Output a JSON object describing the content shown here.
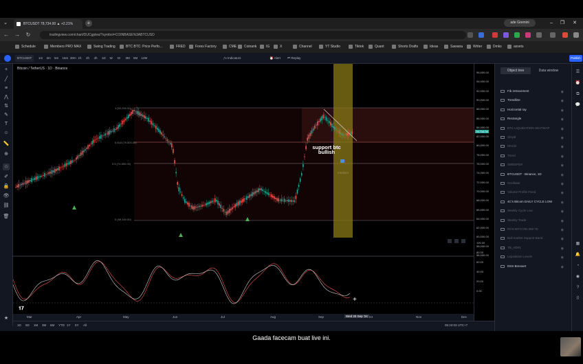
{
  "browser": {
    "tab_title": "BTCUSDT 78,734.00 ▲ +2.21%",
    "new_tab": "+",
    "profile_label": "ade Gremini",
    "url": "tradingview.com/chart/DUCgplea/?symbol=COINBASE%3ABTCUSD",
    "bookmarks": [
      "Schedule",
      "Members PRO MAX",
      "Swing Trading",
      "BTC BTC: Price Perfo...",
      "FRED",
      "Forex Factory",
      "CME",
      "Coinank",
      "IG",
      "X",
      "Channel",
      "YT Studio",
      "Tiktok",
      "Quant",
      "Shorts Drafts",
      "Ideas",
      "Sawana",
      "Writer",
      "Dmks",
      "assets"
    ]
  },
  "toolbar": {
    "symbol": "BTCUSDT",
    "timeframes": [
      "1m",
      "3m",
      "5m",
      "15m",
      "30m",
      "1h",
      "2h",
      "4h",
      "1D",
      "W",
      "M",
      "3M",
      "6M",
      "12M"
    ],
    "indicators_label": "Indicators",
    "alert_label": "Alert",
    "replay_label": "Replay",
    "publish_label": "Publish"
  },
  "chart": {
    "legend": "Bitcoin / TetherUS · 1D · Binance",
    "fib_levels": [
      "1 (92,200.00)",
      "0.618 (79,500.00)",
      "0.5 (74,500.00)",
      "0 (59,100.00)"
    ],
    "annotation_line1": "support btc",
    "annotation_line2": "bullish",
    "annotation_sub": "medium",
    "price_labels": [
      "96,000.00",
      "94,000.00",
      "92,000.00",
      "90,000.00",
      "88,000.00",
      "86,000.00",
      "84,000.00",
      "82,000.00",
      "80,000.00",
      "78,000.00",
      "76,000.00",
      "74,000.00",
      "72,000.00",
      "70,000.00",
      "68,000.00",
      "66,000.00",
      "64,000.00",
      "62,000.00",
      "60,000.00",
      "58,000.00",
      "56,000.00"
    ],
    "current_price": "78,734.00",
    "osc_labels": [
      "100.00",
      "80.00",
      "60.00",
      "40.00",
      "20.00",
      "0.00"
    ],
    "time_labels": [
      "Mar",
      "Apr",
      "May",
      "Jun",
      "Jul",
      "Aug",
      "Sep",
      "Oct",
      "Nov",
      "Dec"
    ],
    "cursor_date": "Wed 25 Sep '24",
    "clock": "05:22:03 UTC+7"
  },
  "bottom": {
    "ranges": [
      "1D",
      "5D",
      "1M",
      "3M",
      "6M",
      "YTD",
      "1Y",
      "5Y",
      "All"
    ]
  },
  "panel": {
    "tabs": [
      "Object tree",
      "Data window"
    ],
    "objects": [
      {
        "label": "Fib retracement",
        "dim": false
      },
      {
        "label": "Trendline",
        "dim": false
      },
      {
        "label": "Horizontal ray",
        "dim": false
      },
      {
        "label": "Rectangle",
        "dim": false
      },
      {
        "label": "BTC LIQUIDATION HEATMAP",
        "dim": true
      },
      {
        "label": "Sinyal",
        "dim": true
      },
      {
        "label": "MACD",
        "dim": true
      },
      {
        "label": "Trend",
        "dim": true
      },
      {
        "label": "SWEEPER",
        "dim": true
      },
      {
        "label": "BTCUSDT · Binance, 1D",
        "dim": false
      },
      {
        "label": "Oscillator",
        "dim": true
      },
      {
        "label": "Volume Profile Fixed",
        "dim": true
      },
      {
        "label": "4C's Bitcoin DAILY CYCLE LOW",
        "dim": false
      },
      {
        "label": "Weekly Cycle Low",
        "dim": true
      },
      {
        "label": "Weekly Trade",
        "dim": true
      },
      {
        "label": "RCN BITCOIN 365 TE",
        "dim": true
      },
      {
        "label": "Bull market Support Band",
        "dim": true
      },
      {
        "label": "TB_ADRL",
        "dim": true
      },
      {
        "label": "Liquidation Levels",
        "dim": true
      },
      {
        "label": "DSS Bressert",
        "dim": false
      }
    ]
  },
  "caption": "Gaada facecam buat live ini.",
  "colors": {
    "bull": "#26a69a",
    "bear": "#ef5350",
    "highlight": "#d4c030",
    "fib_zone": "#2a0d0d"
  }
}
